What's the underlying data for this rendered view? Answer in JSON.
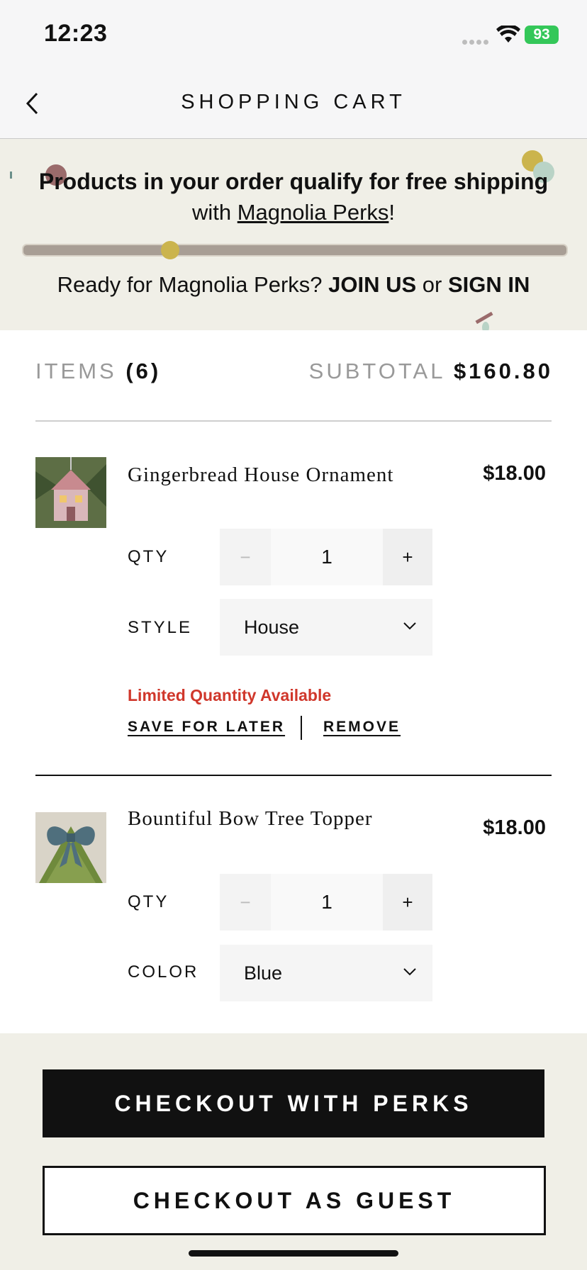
{
  "status_bar": {
    "time": "12:23",
    "battery": "93"
  },
  "nav": {
    "title": "SHOPPING CART"
  },
  "promo": {
    "line1": "Products in your order qualify for free shipping",
    "line2_prefix": "with ",
    "line2_link": "Magnolia Perks",
    "line2_suffix": "!",
    "progress": 0.27,
    "line3_prefix": "Ready for Magnolia Perks? ",
    "join": "JOIN US",
    "or": " or ",
    "signin": "SIGN IN"
  },
  "summary": {
    "items_label": "ITEMS",
    "items_count": "(6)",
    "subtotal_label": "SUBTOTAL",
    "subtotal_value": "$160.80"
  },
  "products": [
    {
      "name": "Gingerbread House Ornament",
      "price": "$18.00",
      "qty_label": "QTY",
      "qty": "1",
      "minus": "−",
      "plus": "+",
      "option_label": "STYLE",
      "option_value": "House",
      "notice": "Limited Quantity Available",
      "save_later": "SAVE FOR LATER",
      "remove": "REMOVE"
    },
    {
      "name": "Bountiful Bow Tree Topper",
      "price": "$18.00",
      "qty_label": "QTY",
      "qty": "1",
      "minus": "−",
      "plus": "+",
      "option_label": "COLOR",
      "option_value": "Blue"
    }
  ],
  "actions": {
    "checkout_perks": "CHECKOUT WITH PERKS",
    "checkout_guest": "CHECKOUT AS GUEST"
  },
  "colors": {
    "banner_bg": "#f0efe7",
    "notice": "#d0372b",
    "primary_button": "#111111"
  }
}
